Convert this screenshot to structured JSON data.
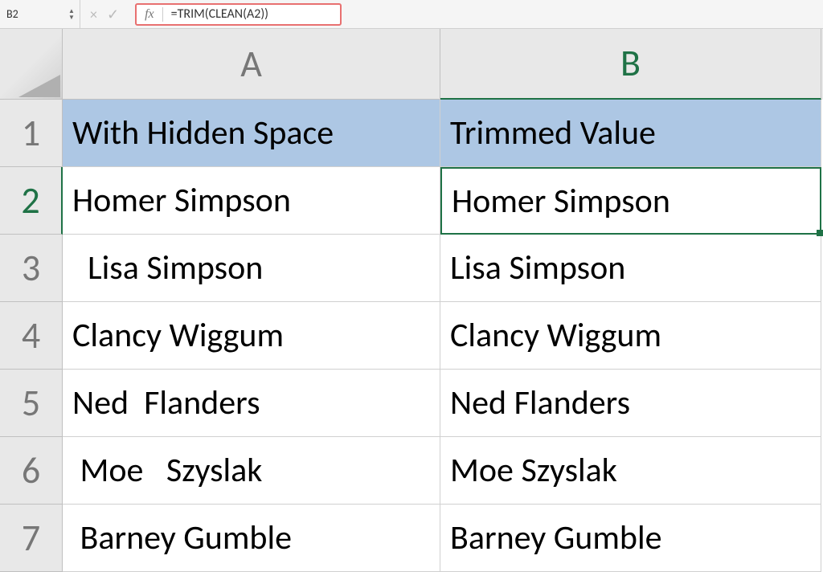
{
  "formula_bar": {
    "name_box": "B2",
    "fx_label": "fx",
    "formula": "=TRIM(CLEAN(A2))",
    "cancel_icon": "×",
    "confirm_icon": "✓",
    "spinner_up": "▲",
    "spinner_down": "▼"
  },
  "columns": {
    "a": "A",
    "b": "B"
  },
  "rows": [
    {
      "num": "1",
      "a": "With Hidden Space",
      "b": "Trimmed Value",
      "is_header": true
    },
    {
      "num": "2",
      "a": "Homer Simpson",
      "b": "Homer Simpson",
      "is_active_row": true
    },
    {
      "num": "3",
      "a": "  Lisa Simpson",
      "b": "Lisa Simpson"
    },
    {
      "num": "4",
      "a": "Clancy Wiggum ",
      "b": "Clancy Wiggum"
    },
    {
      "num": "5",
      "a": "Ned  Flanders",
      "b": "Ned Flanders"
    },
    {
      "num": "6",
      "a": " Moe   Szyslak",
      "b": "Moe Szyslak"
    },
    {
      "num": "7",
      "a": " Barney Gumble ",
      "b": "Barney Gumble"
    }
  ]
}
